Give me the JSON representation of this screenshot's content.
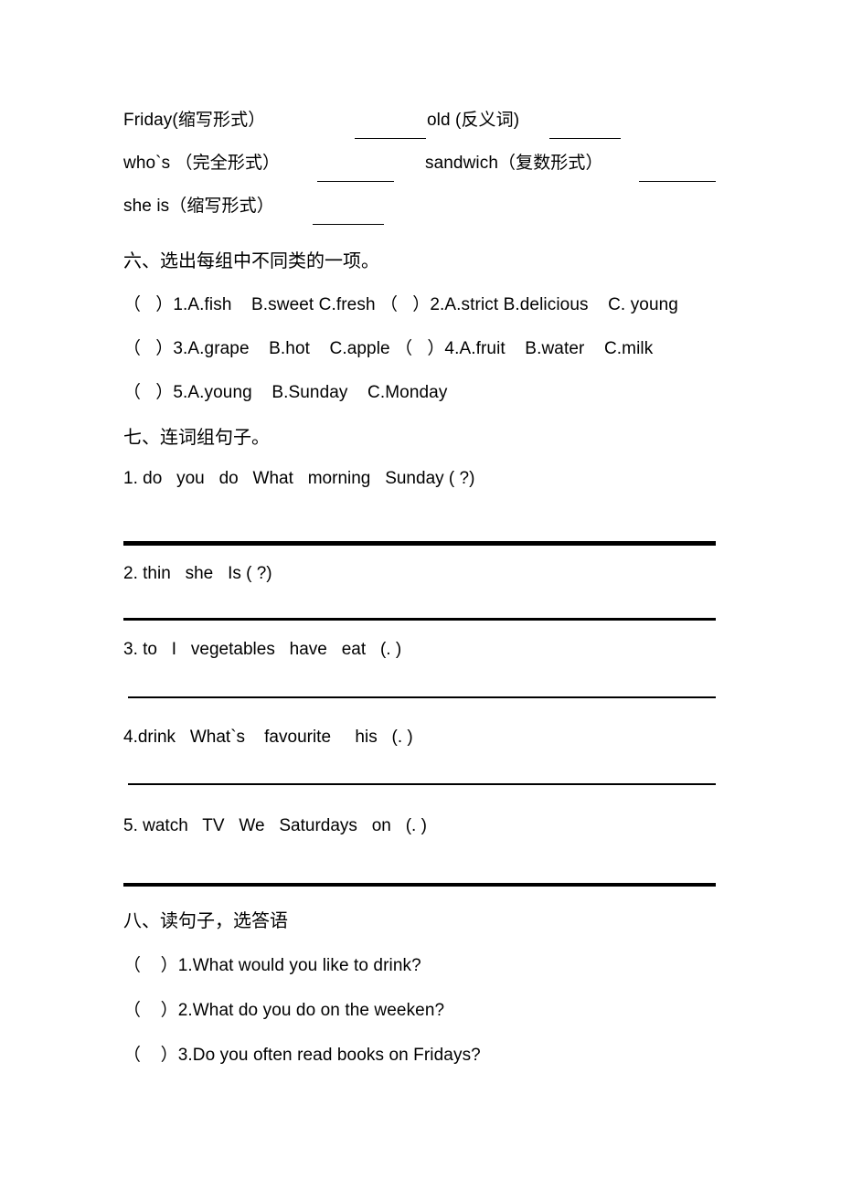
{
  "page": {
    "background": "#ffffff",
    "text_color": "#000000"
  },
  "word_form_section": {
    "lines": [
      {
        "left_prompt": "Friday(缩写形式）",
        "right_prompt": "old (反义词)"
      },
      {
        "left_prompt": "who`s （完全形式）",
        "right_prompt": "sandwich（复数形式）"
      },
      {
        "left_prompt": "she is（缩写形式）",
        "right_prompt": ""
      }
    ]
  },
  "section_six": {
    "heading": "六、选出每组中不同类的一项。",
    "items": [
      "（   ）1.A.fish    B.sweet C.fresh （   ）2.A.strict B.delicious    C. young",
      "（   ）3.A.grape    B.hot    C.apple （   ）4.A.fruit    B.water    C.milk",
      "（   ）5.A.young    B.Sunday    C.Monday"
    ],
    "items_plain": [
      {
        "group1": {
          "number": "1",
          "options": [
            "A.fish",
            "B.sweet",
            "C.fresh"
          ]
        },
        "group2": {
          "number": "2",
          "options": [
            "A.strict",
            "B.delicious",
            "C. young"
          ]
        }
      },
      {
        "group1": {
          "number": "3",
          "options": [
            "A.grape",
            "B.hot",
            "C.apple"
          ]
        },
        "group2": {
          "number": "4",
          "options": [
            "A.fruit",
            "B.water",
            "C.milk"
          ]
        }
      },
      {
        "group1": {
          "number": "5",
          "options": [
            "A.young",
            "B.Sunday",
            "C.Monday"
          ]
        },
        "group2": null
      }
    ]
  },
  "section_seven": {
    "heading": "七、连词组句子。",
    "items": [
      "1. do   you   do   What   morning   Sunday ( ?)",
      "2. thin   she   Is ( ?)",
      "3. to   I   vegetables   have   eat   (. )",
      "4.drink   What`s    favourite     his   (. )",
      "5. watch   TV   We   Saturdays   on   (. )"
    ],
    "answer_rules": [
      {
        "after_item": "1",
        "style": "extra-thick"
      },
      {
        "after_item": "2",
        "style": "medium"
      },
      {
        "after_item": "3",
        "style": "thin"
      },
      {
        "after_item": "4",
        "style": "thin"
      },
      {
        "after_item": "5",
        "style": "thick"
      }
    ]
  },
  "section_eight": {
    "heading": "八、读句子，选答语",
    "items": [
      "（    ）1.What would you like to drink?",
      "（    ）2.What do you do on the weeken?",
      "（    ）3.Do you often read books on Fridays?"
    ]
  }
}
